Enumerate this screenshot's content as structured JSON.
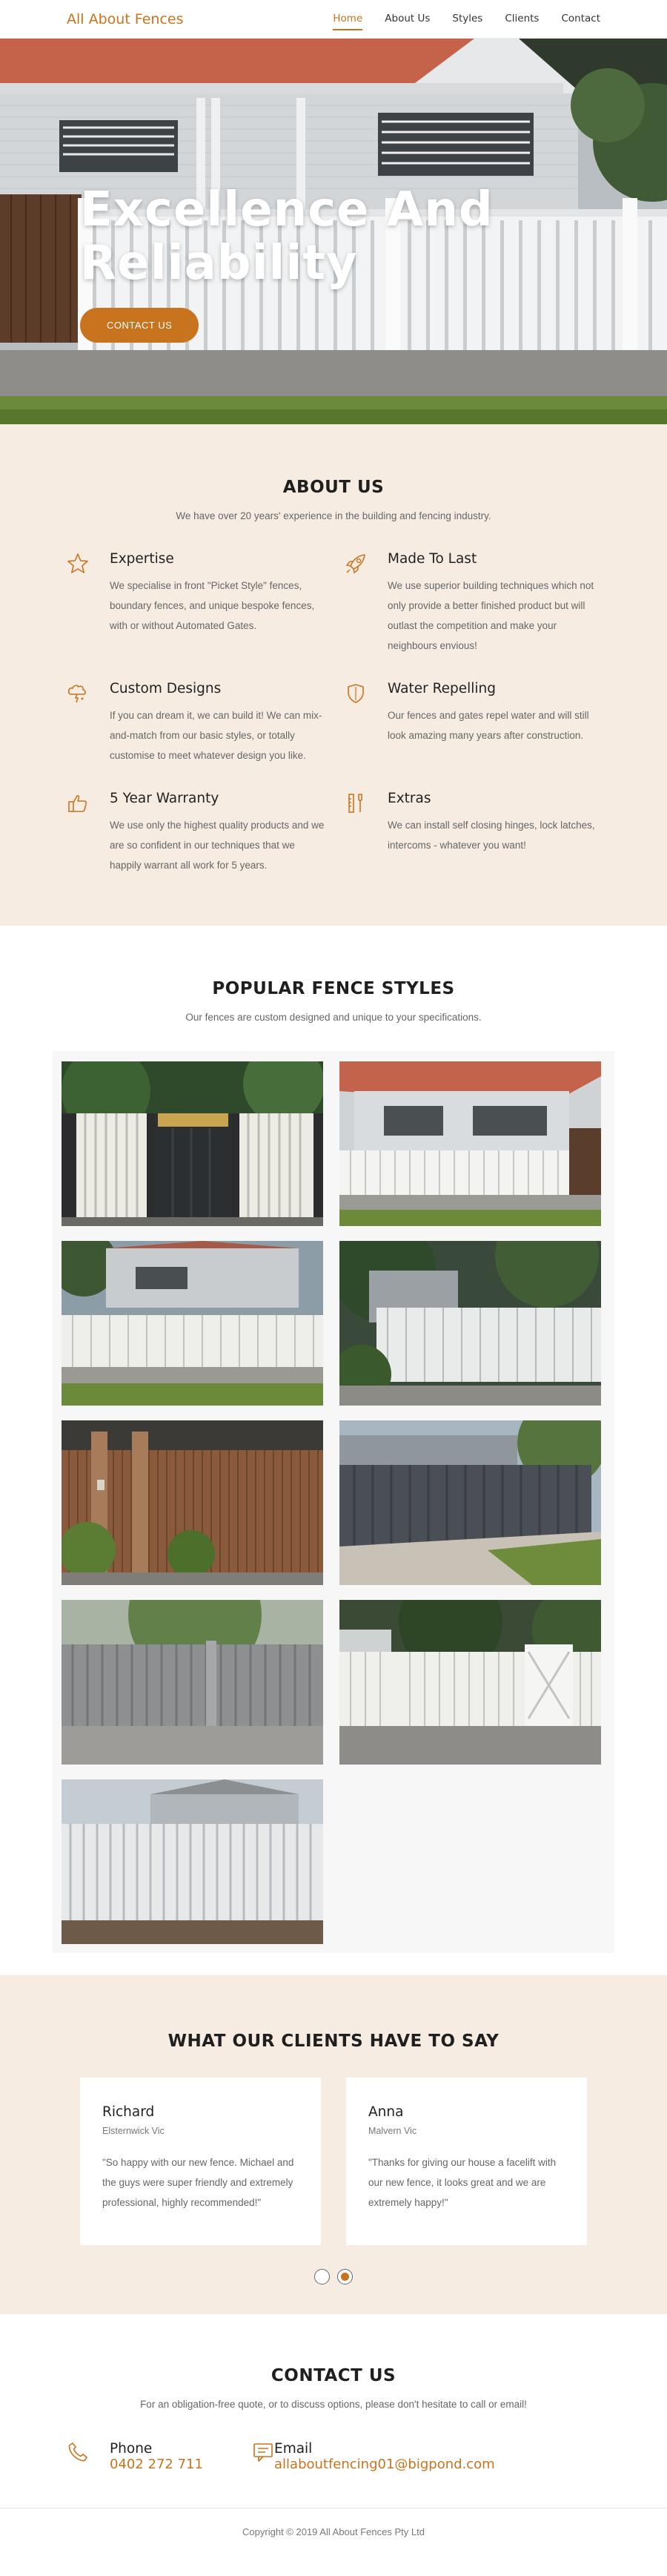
{
  "nav": {
    "brand": "All About Fences",
    "links": [
      "Home",
      "About Us",
      "Styles",
      "Clients",
      "Contact"
    ]
  },
  "hero": {
    "title": "Excellence And Reliability",
    "button": "CONTACT US"
  },
  "about": {
    "title": "ABOUT US",
    "subtitle": "We have over 20 years' experience in the building and fencing industry.",
    "features": [
      {
        "icon": "star-icon",
        "title": "Expertise",
        "text": "We specialise in front \"Picket Style\" fences, boundary fences, and unique bespoke fences, with or without Automated Gates."
      },
      {
        "icon": "rocket-icon",
        "title": "Made To Last",
        "text": "We use superior building techniques which not only provide a better finished product but will outlast the competition and make your neighbours envious!"
      },
      {
        "icon": "lightbulb-icon",
        "title": "Custom Designs",
        "text": "If you can dream it, we can build it! We can mix-and-match from our basic styles, or totally customise to meet whatever design you like."
      },
      {
        "icon": "shield-icon",
        "title": "Water Repelling",
        "text": "Our fences and gates repel water and will still look amazing many years after construction."
      },
      {
        "icon": "thumbs-up-icon",
        "title": "5 Year Warranty",
        "text": "We use only the highest quality products and we are so confident in our techniques that we happily warrant all work for 5 years."
      },
      {
        "icon": "tools-icon",
        "title": "Extras",
        "text": "We can install self closing hinges, lock latches, intercoms - whatever you want!"
      }
    ]
  },
  "styles": {
    "title": "POPULAR FENCE STYLES",
    "subtitle": "Our fences are custom designed and unique to your specifications."
  },
  "clients": {
    "title": "WHAT OUR CLIENTS HAVE TO SAY",
    "testimonials": [
      {
        "name": "Richard",
        "location": "Elsternwick Vic",
        "quote": "\"So happy with our new fence. Michael and the guys were super friendly and extremely professional, highly recommended!\""
      },
      {
        "name": "Anna",
        "location": "Malvern Vic",
        "quote": "\"Thanks for giving our house a facelift with our new fence, it looks great and we are extremely happy!\""
      }
    ]
  },
  "contact": {
    "title": "CONTACT US",
    "subtitle": "For an obligation-free quote, or to discuss options, please don't hesitate to call or email!",
    "phone_label": "Phone",
    "phone": "0402 272 711",
    "email_label": "Email",
    "email": "allaboutfencing01@bigpond.com"
  },
  "footer": {
    "text": "Copyright © 2019 All About Fences Pty Ltd"
  },
  "colors": {
    "accent": "#c8741f",
    "section_bg": "#f7ece2"
  }
}
